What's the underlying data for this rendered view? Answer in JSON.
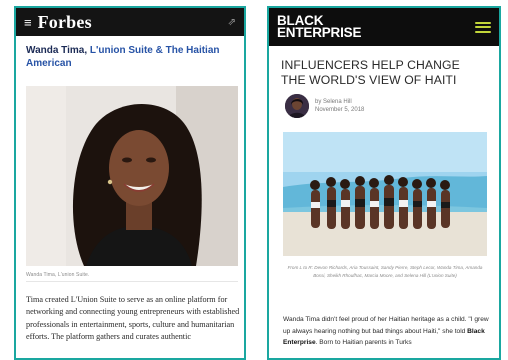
{
  "forbes": {
    "menu_icon": "≡",
    "logo": "Forbes",
    "share_icon": "⇗",
    "title_prefix": "Wanda Tima, ",
    "title_link": "L'union Suite & The Haitian American",
    "photo_caption": "Wanda Tima, L'union Suite.",
    "body": "Tima created L'Union Suite to serve as an online platform for networking and connecting young entrepreneurs with established professionals in entertainment, sports, culture and humanitarian efforts. The platform gathers and curates authentic"
  },
  "black_enterprise": {
    "logo_line1": "BLACK",
    "logo_line2": "ENTERPRISE",
    "menu_icon": "hamburger-icon",
    "accent_color": "#c2d63a",
    "headline": "INFLUENCERS HELP CHANGE THE WORLD'S VIEW OF HAITI",
    "author": "by Selena Hill",
    "date": "November 5, 2018",
    "photo_caption": "From L to R: Devon Richards, Aria Toussaint, Sandy Pierre, Steph Lecor, Wanda Tima, Amanda Bossi, Sheikh Rhoufhac, Marcia Moore, and Selena Hill (L'union Suite)",
    "body_part1": "Wanda Tima didn't feel proud of her Haitian heritage as a child. \"I grew up always hearing nothing but bad things about Haiti,\" she told ",
    "body_bold": "Black Enterprise",
    "body_part2": ". Born to Haitian parents in Turks"
  },
  "frame_color": "#1aa7a0"
}
